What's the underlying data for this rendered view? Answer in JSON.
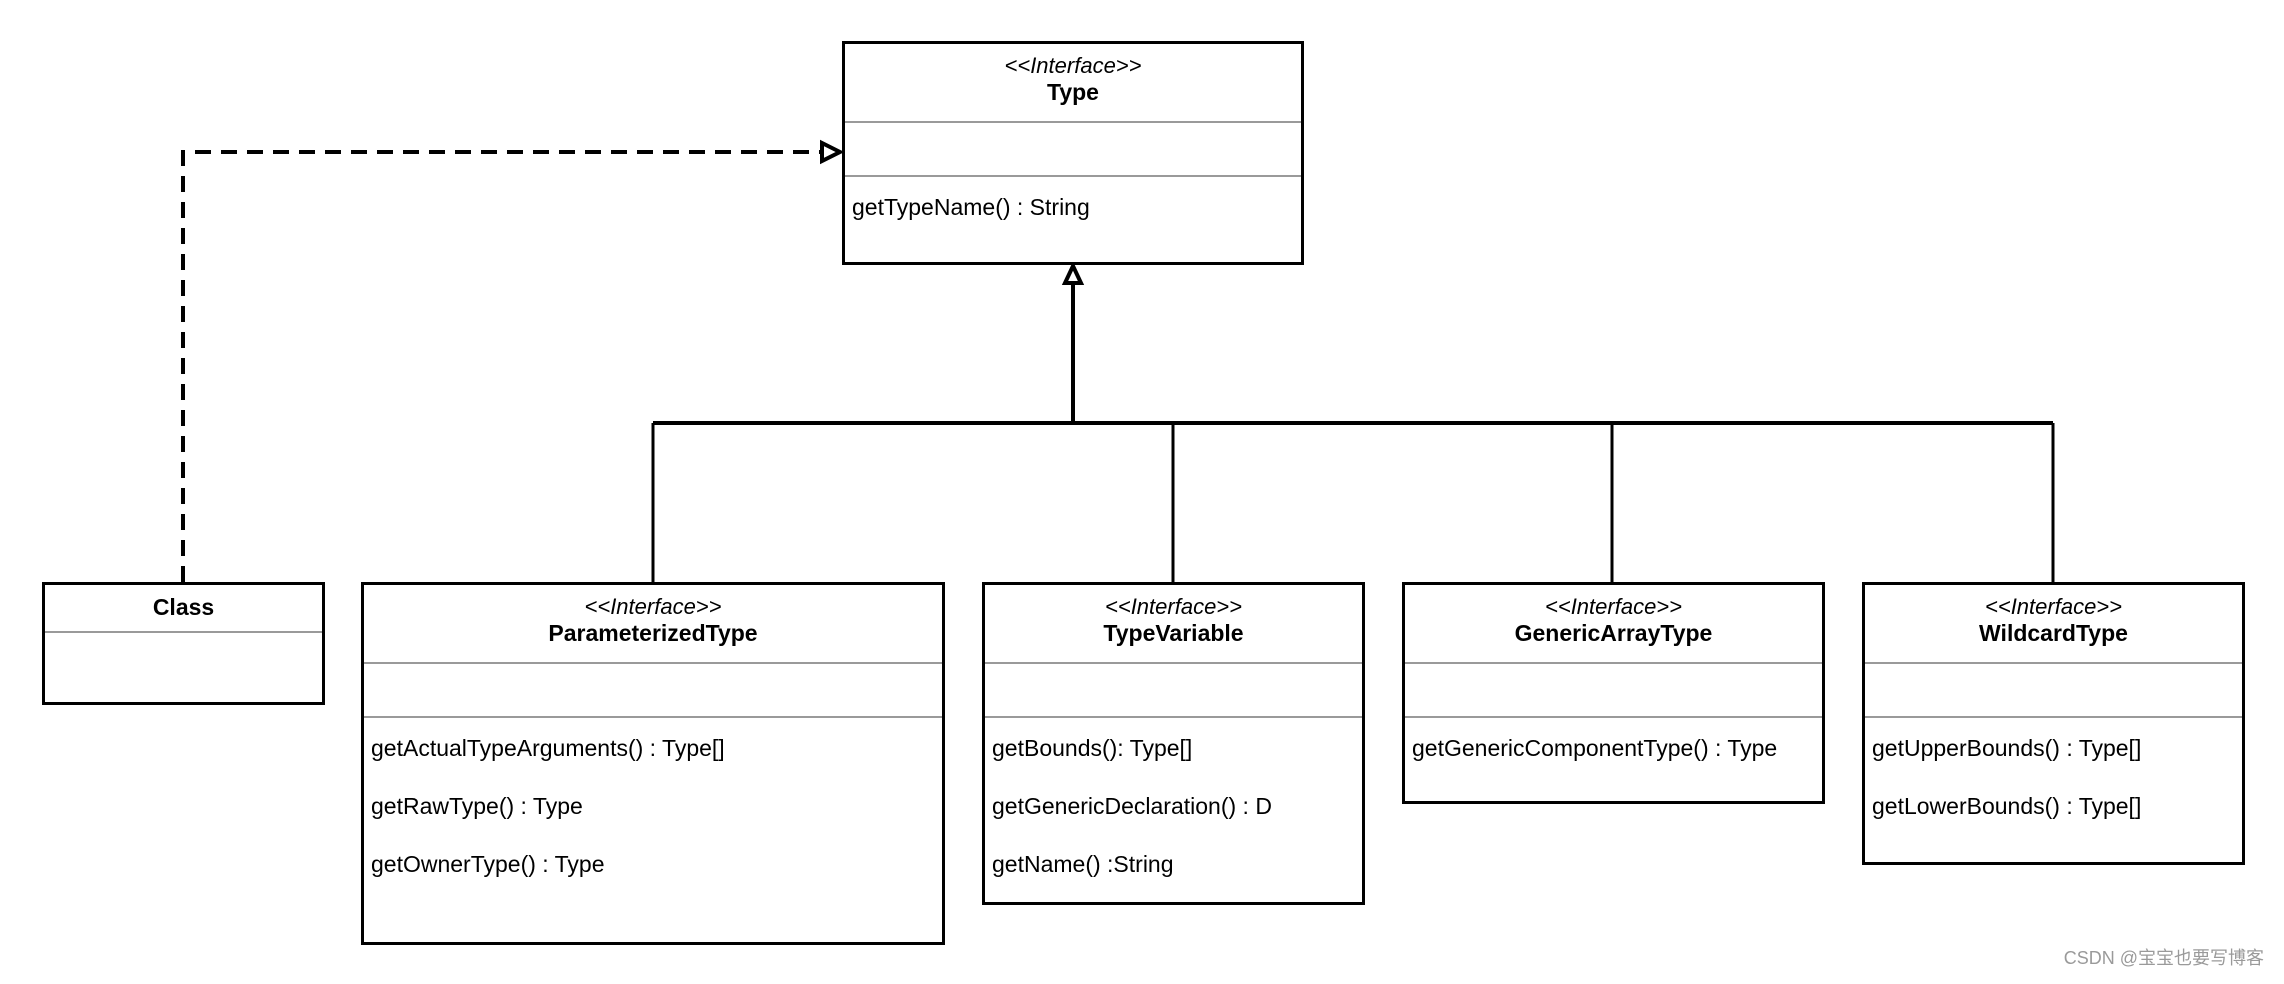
{
  "diagram": {
    "type": "UML class diagram",
    "classes": {
      "type": {
        "stereotype": "<<Interface>>",
        "name": "Type",
        "methods": [
          "getTypeName() : String"
        ]
      },
      "class": {
        "name": "Class"
      },
      "parameterized": {
        "stereotype": "<<Interface>>",
        "name": "ParameterizedType",
        "methods": [
          "getActualTypeArguments() : Type[]",
          "getRawType() : Type",
          "getOwnerType() : Type"
        ]
      },
      "typevariable": {
        "stereotype": "<<Interface>>",
        "name": "TypeVariable",
        "methods": [
          "getBounds(): Type[]",
          "getGenericDeclaration() : D",
          "getName() :String"
        ]
      },
      "genericarray": {
        "stereotype": "<<Interface>>",
        "name": "GenericArrayType",
        "methods": [
          "getGenericComponentType() : Type"
        ]
      },
      "wildcard": {
        "stereotype": "<<Interface>>",
        "name": "WildcardType",
        "methods": [
          "getUpperBounds() : Type[]",
          "getLowerBounds() : Type[]"
        ]
      }
    },
    "relationships": [
      {
        "from": "Class",
        "to": "Type",
        "kind": "realization"
      },
      {
        "from": "ParameterizedType",
        "to": "Type",
        "kind": "generalization"
      },
      {
        "from": "TypeVariable",
        "to": "Type",
        "kind": "generalization"
      },
      {
        "from": "GenericArrayType",
        "to": "Type",
        "kind": "generalization"
      },
      {
        "from": "WildcardType",
        "to": "Type",
        "kind": "generalization"
      }
    ]
  },
  "watermark": "CSDN @宝宝也要写博客"
}
